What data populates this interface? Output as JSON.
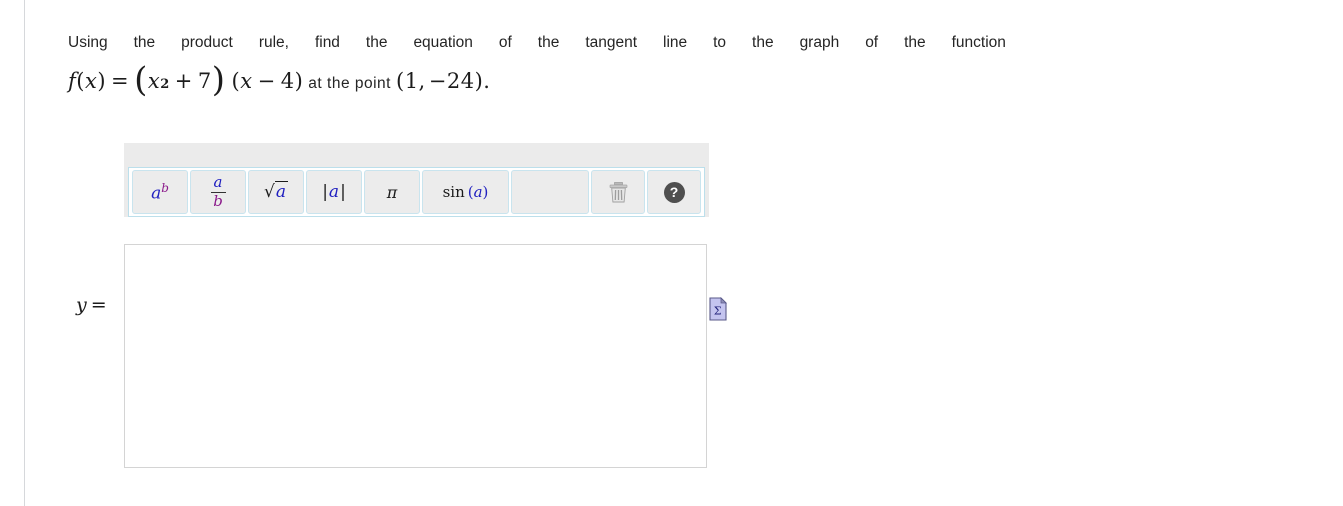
{
  "question": {
    "line1_words": [
      "Using",
      "the",
      "product",
      "rule,",
      "find",
      "the",
      "equation",
      "of",
      "the",
      "tangent",
      "line",
      "to",
      "the",
      "graph",
      "of",
      "the",
      "function"
    ],
    "formula": {
      "fx": "f",
      "fx_arg_open": "(",
      "fx_var": "x",
      "fx_arg_close": ")",
      "equals": "=",
      "paren_open": "(",
      "term_var": "x",
      "term_exp": "2",
      "term_plus": "+",
      "term_const": "7",
      "paren_close": ")",
      "factor_open": "(",
      "factor_var": "x",
      "factor_minus": "−",
      "factor_const": "4",
      "factor_close": ")",
      "tail_text": "at the point",
      "point_open": "(",
      "point_x": "1,",
      "point_y": "−24",
      "point_close": ")",
      "period": "."
    }
  },
  "math_toolbar": {
    "buttons": [
      {
        "name": "exponent",
        "label": "a^b",
        "base": "a",
        "exp": "b"
      },
      {
        "name": "fraction",
        "label": "a/b",
        "numerator": "a",
        "denominator": "b"
      },
      {
        "name": "square-root",
        "label": "sqrt(a)",
        "radicand": "a",
        "radical": "√"
      },
      {
        "name": "absolute-value",
        "label": "|a|",
        "bar": "|",
        "inner": "a"
      },
      {
        "name": "pi",
        "label": "π"
      },
      {
        "name": "sine",
        "label": "sin(a)",
        "fn": "sin",
        "open": "(",
        "arg": "a",
        "close": ")"
      }
    ],
    "spacer": "",
    "delete_button": {
      "name": "trash-icon",
      "tooltip": "Clear"
    },
    "help_button": {
      "name": "help-icon",
      "label": "?"
    }
  },
  "answer": {
    "prefix_y": "y",
    "prefix_equals": "=",
    "value": "",
    "placeholder": ""
  },
  "preview": {
    "icon_glyph": "Σ",
    "name": "math-preview-icon"
  },
  "colors": {
    "panel_bg": "#ebebeb",
    "toolbar_border": "#bcdfeb",
    "button_bg": "#ececec",
    "button_border": "#c9e4ee",
    "glyph_blue": "#2020c0",
    "glyph_purple": "#8b1a8b",
    "text": "#252525",
    "box_border": "#d4d4d4",
    "page_rule": "#d6d8db",
    "help_bg": "#4f4f4f",
    "sigma_fill": "#c4c4ef"
  }
}
